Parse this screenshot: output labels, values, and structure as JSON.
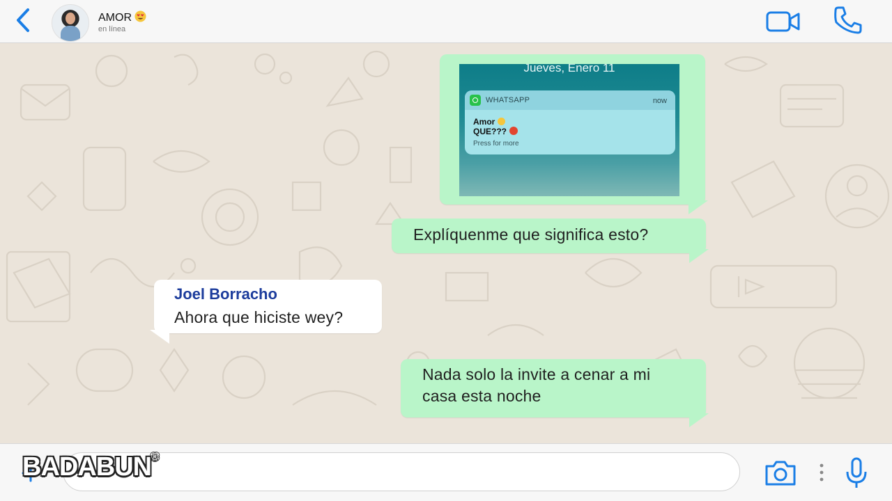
{
  "header": {
    "contact_name": "AMOR",
    "contact_status": "en línea"
  },
  "messages": {
    "screenshot": {
      "date": "Jueves, Enero 11",
      "app": "WHATSAPP",
      "time": "now",
      "title": "Amor",
      "body": "QUE???",
      "hint": "Press for more"
    },
    "out_1": "Explíquenme que significa esto?",
    "in_1": {
      "sender": "Joel Borracho",
      "text": "Ahora que hiciste wey?"
    },
    "out_2_line1": "Nada solo la invite a cenar a mi",
    "out_2_line2": "casa esta noche"
  },
  "input": {
    "placeholder": ""
  },
  "watermark": "BADABUN",
  "colors": {
    "accent": "#1a7ee6",
    "outgoing_bubble": "#b9f5c9",
    "incoming_bubble": "#ffffff",
    "sender_name": "#1c3c9c"
  },
  "icons": {
    "back": "chevron-left-icon",
    "video": "video-camera-icon",
    "call": "phone-icon",
    "attach": "plus-icon",
    "camera": "camera-icon",
    "more": "dots-vertical-icon",
    "mic": "microphone-icon"
  }
}
